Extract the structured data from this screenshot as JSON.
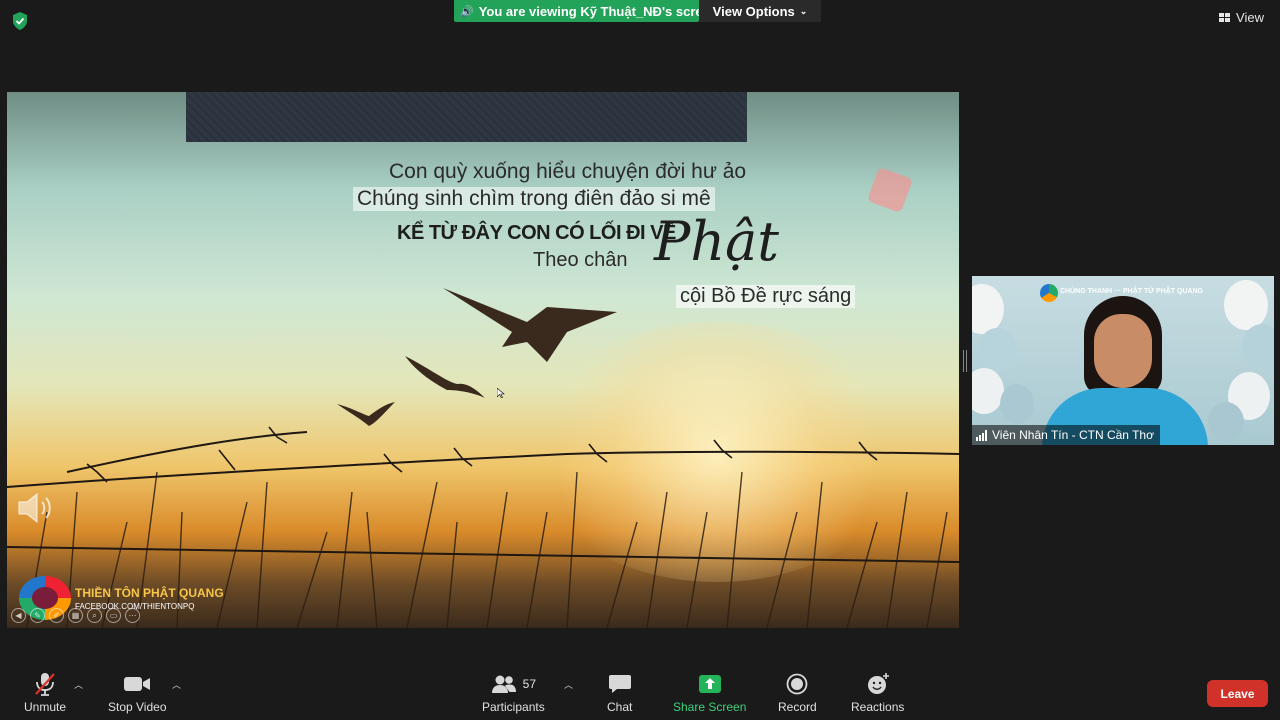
{
  "top_bar": {
    "viewing_banner": "You are viewing Kỹ Thuật_NĐ's screen",
    "view_options": "View Options",
    "view_label": "View"
  },
  "shared_screen": {
    "poem_lines": [
      "Con quỳ xuống hiểu chuyện đời hư ảo",
      "Chúng sinh chìm trong điên đảo si mê",
      "KỂ TỪ ĐÂY CON CÓ LỐI ĐI VỀ",
      "Theo chân",
      "cội Bồ Đề rực sáng"
    ],
    "script_word": "Phật",
    "brand_name": "THIỀN TÔN PHẬT QUANG",
    "brand_facebook": "FACEBOOK.COM/THIENTONPQ"
  },
  "participant_video": {
    "banner_text": "CHÙNG THANH ··· PHẬT TỬ PHẬT QUANG",
    "name": "Viên Nhân Tín - CTN Cần Thơ"
  },
  "toolbar": {
    "unmute": "Unmute",
    "stop_video": "Stop Video",
    "participants": "Participants",
    "participants_count": "57",
    "chat": "Chat",
    "share_screen": "Share Screen",
    "record": "Record",
    "reactions": "Reactions",
    "leave": "Leave"
  },
  "colors": {
    "banner_green": "#23a35a",
    "share_green": "#3fd07e",
    "leave_red": "#d0322a",
    "background": "#1a1a1a"
  }
}
